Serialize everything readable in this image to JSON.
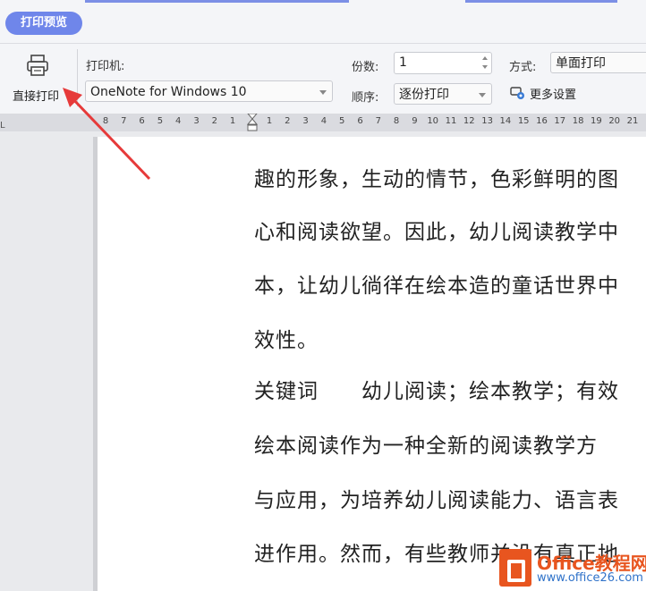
{
  "header": {
    "tab_label": "打印预览"
  },
  "toolbar": {
    "direct_print_label": "直接打印",
    "printer_label": "打印机:",
    "printer_value": "OneNote for Windows 10",
    "copies_label": "份数:",
    "copies_value": "1",
    "order_label": "顺序:",
    "order_value": "逐份打印",
    "mode_label": "方式:",
    "mode_value": "单面打印",
    "more_settings_label": "更多设置"
  },
  "ruler": {
    "left_ticks": [
      "8",
      "7",
      "6",
      "5",
      "4",
      "3",
      "2",
      "1"
    ],
    "right_ticks": [
      "1",
      "2",
      "3",
      "4",
      "5",
      "6",
      "7",
      "8",
      "9",
      "10",
      "11",
      "12",
      "13",
      "14",
      "15",
      "16",
      "17",
      "18",
      "19",
      "20",
      "21"
    ],
    "corner": "L"
  },
  "document": {
    "lines": [
      "趣的形象，生动的情节，色彩鲜明的图",
      "心和阅读欲望。因此，幼儿阅读教学中",
      "本，让幼儿徜徉在绘本造的童话世界中",
      "效性。",
      "关键词　　幼儿阅读；绘本教学；有效",
      "绘本阅读作为一种全新的阅读教学方",
      "与应用，为培养幼儿阅读能力、语言表",
      "进作用。然而，有些教师并没有真正地"
    ]
  },
  "watermark": {
    "brand": "Office教程网",
    "url": "www.office26.com"
  },
  "colors": {
    "accent": "#6f86ea",
    "arrow": "#e63a3a",
    "brand": "#e8551f"
  }
}
